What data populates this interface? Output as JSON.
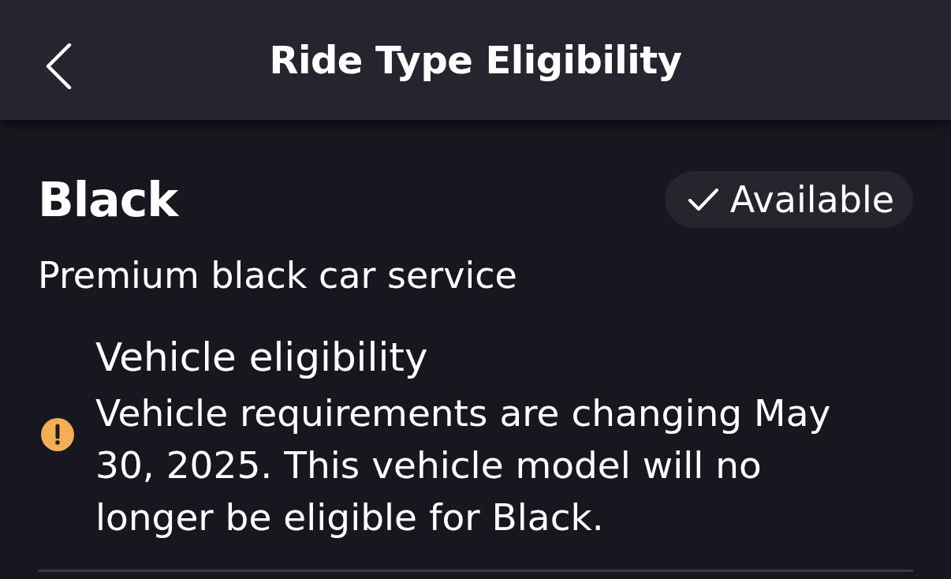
{
  "header": {
    "title": "Ride Type Eligibility"
  },
  "ride_type": {
    "name": "Black",
    "status": {
      "label": "Available",
      "available": true
    },
    "description": "Premium black car service"
  },
  "notices": [
    {
      "kind": "warning",
      "title": "Vehicle eligibility",
      "message": "Vehicle requirements are changing May 30, 2025. This vehicle model will no longer be eligible for Black."
    }
  ]
}
